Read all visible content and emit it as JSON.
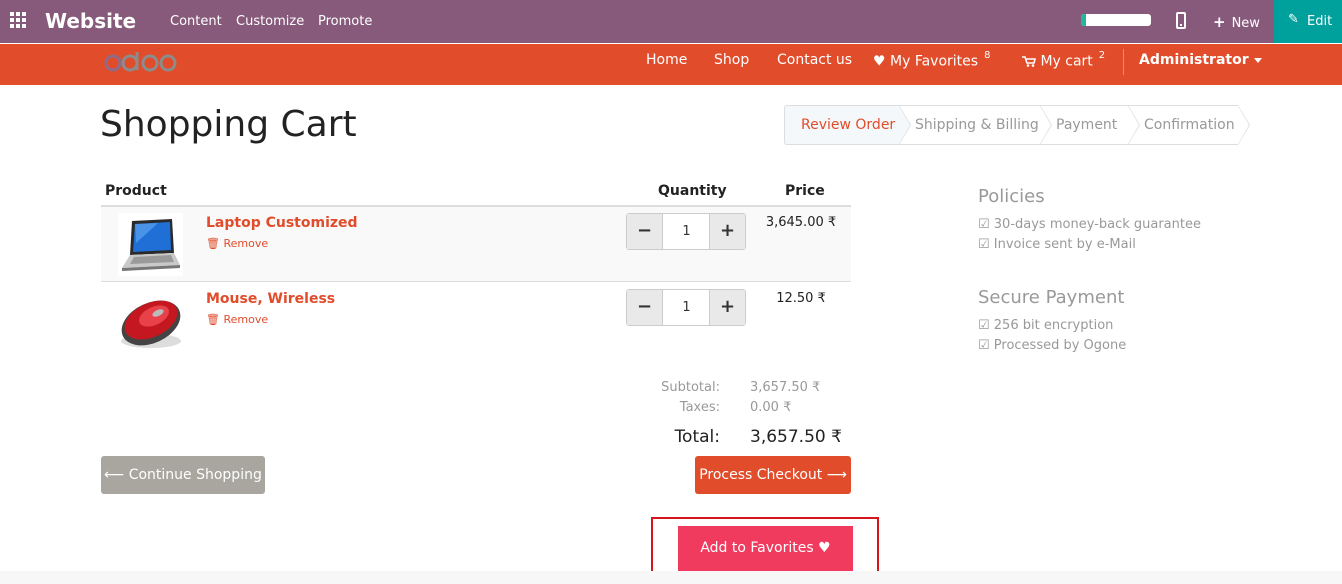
{
  "admin_bar": {
    "brand": "Website",
    "menu": [
      "Content",
      "Customize",
      "Promote"
    ],
    "new_label": "New",
    "edit_label": "Edit"
  },
  "navbar": {
    "logo_text": "odoo",
    "links": {
      "home": "Home",
      "shop": "Shop",
      "contact": "Contact us",
      "favorites": "My Favorites",
      "favorites_count": "8",
      "cart": "My cart",
      "cart_count": "2",
      "user": "Administrator"
    }
  },
  "page": {
    "title": "Shopping Cart"
  },
  "wizard": {
    "steps": [
      "Review Order",
      "Shipping & Billing",
      "Payment",
      "Confirmation"
    ],
    "active": "Review Order"
  },
  "cart": {
    "columns": {
      "product": "Product",
      "quantity": "Quantity",
      "price": "Price"
    },
    "items": [
      {
        "name": "Laptop Customized",
        "remove_label": "Remove",
        "quantity": "1",
        "price": "3,645.00 ₹"
      },
      {
        "name": "Mouse, Wireless",
        "remove_label": "Remove",
        "quantity": "1",
        "price": "12.50 ₹"
      }
    ],
    "totals": {
      "subtotal_label": "Subtotal:",
      "subtotal": "3,657.50 ₹",
      "taxes_label": "Taxes:",
      "taxes": "0.00 ₹",
      "total_label": "Total:",
      "total": "3,657.50 ₹"
    }
  },
  "actions": {
    "continue": "Continue Shopping",
    "checkout": "Process Checkout",
    "favorites": "Add to Favorites"
  },
  "sidebar": {
    "policies_title": "Policies",
    "policies": [
      "☑ 30-days money-back guarantee",
      "☑ Invoice sent by e-Mail"
    ],
    "payment_title": "Secure Payment",
    "payment": [
      "☑ 256 bit encryption",
      "☑ Processed by Ogone"
    ]
  },
  "colors": {
    "admin_bar": "#875a7b",
    "navbar": "#e14c2b",
    "edit_button": "#00a09d",
    "favorite_button": "#f03b5e",
    "highlight_box": "#d9141b"
  }
}
